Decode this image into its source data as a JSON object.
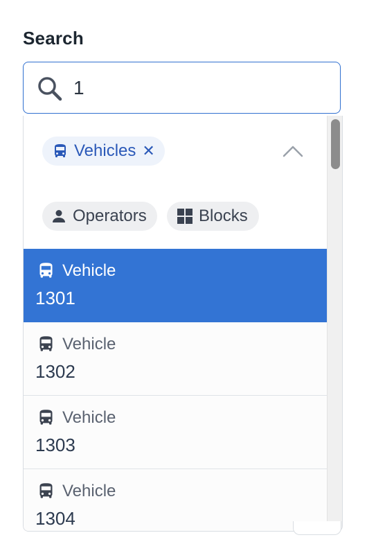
{
  "search": {
    "label": "Search",
    "value": "1",
    "placeholder": ""
  },
  "filters": {
    "active": [
      {
        "label": "Vehicles",
        "icon": "bus-icon",
        "remove_icon": "close-icon"
      }
    ],
    "available": [
      {
        "label": "Operators",
        "icon": "person-icon"
      },
      {
        "label": "Blocks",
        "icon": "blocks-icon"
      }
    ],
    "toggle_icon": "chevron-up-icon"
  },
  "results": [
    {
      "type": "Vehicle",
      "number": "1301",
      "icon": "bus-icon",
      "selected": true
    },
    {
      "type": "Vehicle",
      "number": "1302",
      "icon": "bus-icon",
      "selected": false
    },
    {
      "type": "Vehicle",
      "number": "1303",
      "icon": "bus-icon",
      "selected": false
    },
    {
      "type": "Vehicle",
      "number": "1304",
      "icon": "bus-icon",
      "selected": false
    }
  ],
  "colors": {
    "accent": "#3374d4",
    "focus_border": "#2f6fd0",
    "active_chip_bg": "#eef3fb",
    "active_chip_text": "#2b59b8",
    "inactive_chip_bg": "#eeeff1",
    "label_text": "#1c2630"
  }
}
